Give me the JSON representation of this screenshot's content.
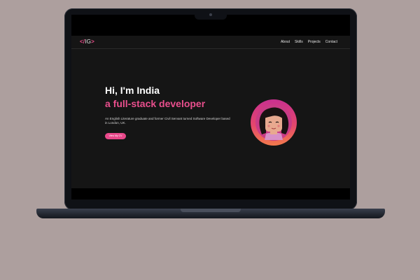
{
  "site": {
    "logo": {
      "open": "</",
      "initials": "IG",
      "close": ">"
    },
    "nav": [
      {
        "label": "About"
      },
      {
        "label": "Skills"
      },
      {
        "label": "Projects"
      },
      {
        "label": "Contact"
      }
    ],
    "hero": {
      "greeting": "Hi, I'm India",
      "tagline": "a full-stack developer",
      "description": "An English Literature graduate and former Civil Servant turned Software Developer based in London, UK.",
      "cta_label": "View My CV"
    }
  },
  "colors": {
    "accent": "#e94f8d",
    "page_background": "#151515",
    "backdrop": "#ad9f9e"
  }
}
